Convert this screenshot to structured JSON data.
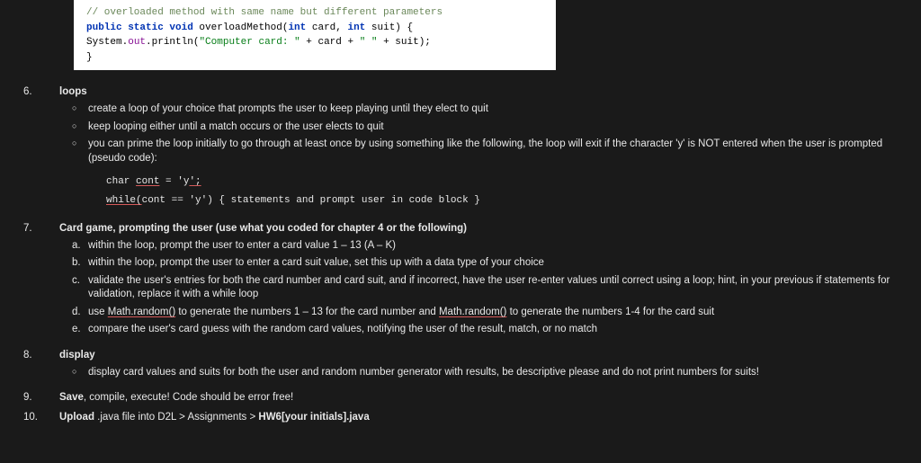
{
  "code_snippet": {
    "comment": "// overloaded method with same name but different parameters",
    "sig_kw1": "public static void",
    "sig_name": " overloadMethod(",
    "sig_kw2": "int",
    "sig_p1": " card, ",
    "sig_kw3": "int",
    "sig_p2": " suit) {",
    "body_pre": "    System.",
    "body_field": "out",
    "body_mid": ".println(",
    "body_str1": "\"Computer card: \"",
    "body_mid2": " + card + ",
    "body_str2": "\" \"",
    "body_mid3": " + suit);",
    "close": "}"
  },
  "items": [
    {
      "num": "6.",
      "title": "loops",
      "bullets": [
        "create a loop of your choice that prompts the user to keep playing until they elect to quit",
        "keep looping either until a match occurs or the user elects to quit",
        "you can prime the loop initially to go through at least once by using something like the following, the loop will exit if the character 'y' is NOT entered when the user is prompted (pseudo code):"
      ],
      "pseudo": {
        "line1_pre": "char ",
        "line1_u": "cont",
        "line1_post": " = 'y",
        "line1_u2": "';",
        "line2_u": "while(",
        "line2_mid": "cont == 'y')  { statements and prompt user in code block }"
      }
    },
    {
      "num": "7.",
      "title": "Card game, prompting the user (use what you coded for chapter 4 or the following)",
      "letters": [
        {
          "mark": "a.",
          "text": "within the loop, prompt the user to enter a card value 1 – 13 (A – K)"
        },
        {
          "mark": "b.",
          "text": "within the loop, prompt the user to enter a card suit value, set this up with a data type of your choice"
        },
        {
          "mark": "c.",
          "text": "validate the user's entries for both the card number and card suit, and if incorrect, have the user re-enter values until correct using a loop; hint, in your previous if statements for validation, replace it with a while loop"
        },
        {
          "mark": "d.",
          "pre": "use ",
          "u1": "Math.random()",
          "mid": " to generate the numbers 1 – 13 for the card number and ",
          "u2": "Math.random()",
          "post": " to generate the numbers 1-4 for the card suit"
        },
        {
          "mark": "e.",
          "text": "compare the user's card guess with the random card values, notifying the user of the result, match, or no match"
        }
      ]
    },
    {
      "num": "8.",
      "title": "display",
      "bullets": [
        "display card values and suits for both the user and random number generator with results, be descriptive please and do not print numbers for suits!"
      ]
    },
    {
      "num": "9.",
      "title_bold": "Save",
      "title_rest": ", compile, execute!   Code should be error free!"
    },
    {
      "num": "10.",
      "title_bold": "Upload",
      "title_rest": " .java file into D2L > Assignments > ",
      "title_bold2": "HW6[your initials].java"
    }
  ]
}
